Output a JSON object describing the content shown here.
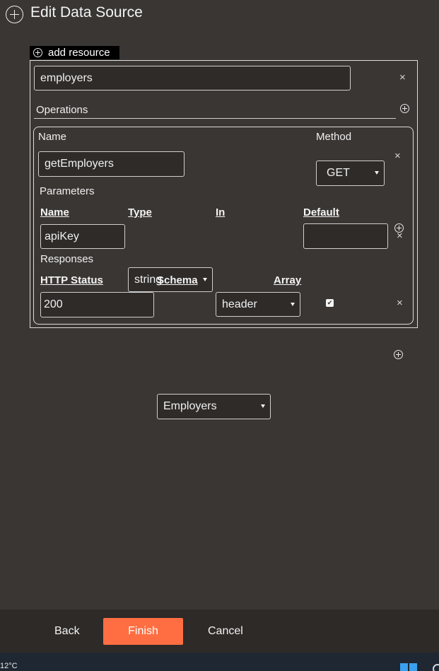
{
  "header": {
    "title": "Edit Data Source"
  },
  "resource": {
    "add_label": "add resource",
    "name_value": "employers"
  },
  "operations": {
    "label": "Operations",
    "name_label": "Name",
    "method_label": "Method",
    "name_value": "getEmployers",
    "method_value": "GET",
    "parameters": {
      "label": "Parameters",
      "columns": [
        "Name",
        "Type",
        "In",
        "Default"
      ],
      "row": {
        "name": "apiKey",
        "type": "string",
        "in": "header",
        "default": ""
      }
    },
    "responses": {
      "label": "Responses",
      "columns": [
        "HTTP Status",
        "Schema",
        "Array"
      ],
      "row": {
        "status": "200",
        "schema": "Employers",
        "array_checked": true
      }
    }
  },
  "footer": {
    "back_label": "Back",
    "finish_label": "Finish",
    "cancel_label": "Cancel"
  },
  "taskbar": {
    "temperature": "12°C"
  },
  "icons": {
    "close": "×",
    "check": "✔"
  },
  "colors": {
    "background": "#3a3634",
    "accent": "#ff6e42",
    "footer": "#2d2a28"
  }
}
